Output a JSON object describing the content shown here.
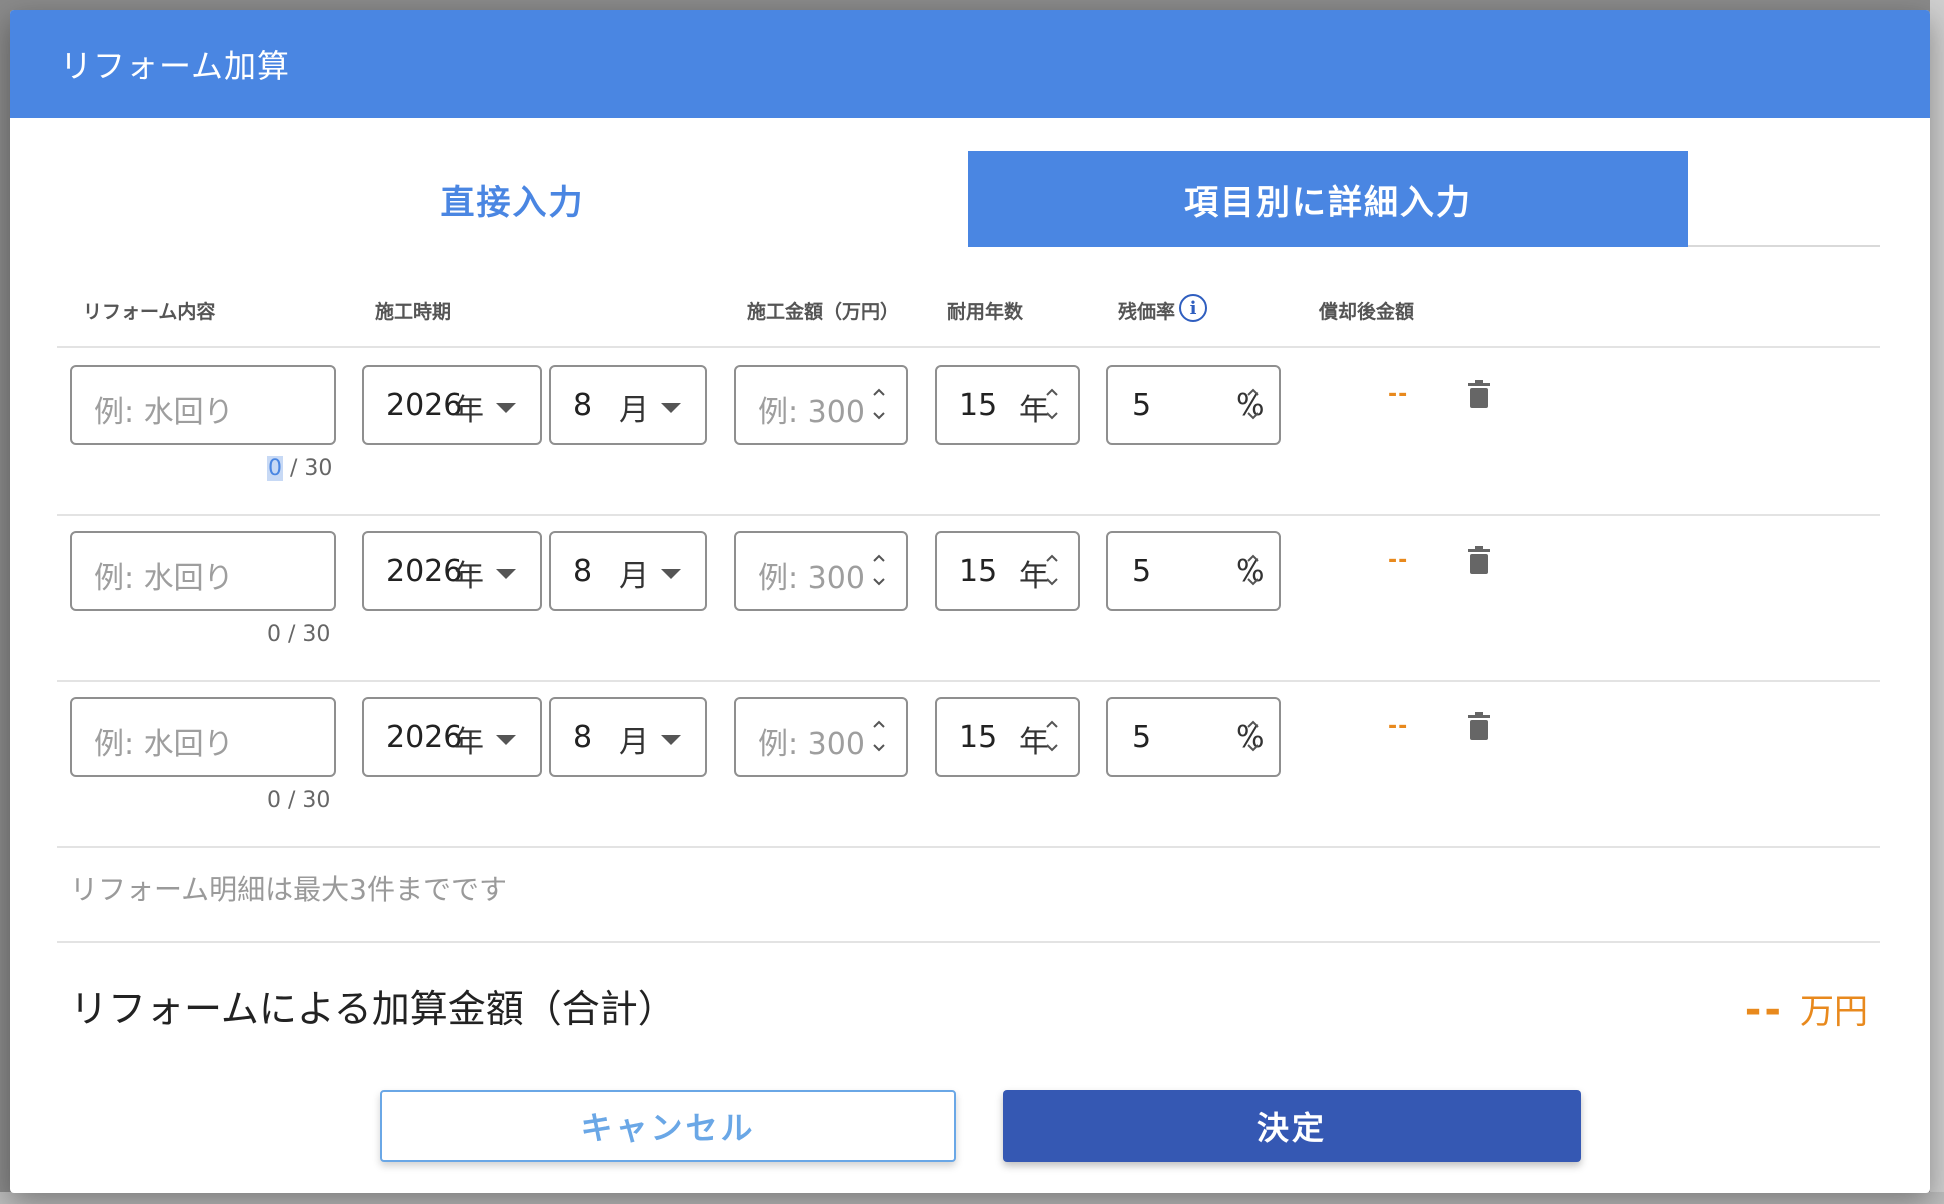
{
  "dialog": {
    "title": "リフォーム加算"
  },
  "tabs": [
    {
      "label": "直接入力",
      "active": false
    },
    {
      "label": "項目別に詳細入力",
      "active": true
    }
  ],
  "columns": {
    "content": "リフォーム内容",
    "period": "施工時期",
    "amount": "施工金額（万円）",
    "life": "耐用年数",
    "residual": "残価率",
    "after": "償却後金額"
  },
  "rows": [
    {
      "content_placeholder": "例: 水回り",
      "counter_current": "0",
      "counter_rest": " / 30",
      "year": "2026",
      "year_unit": "年",
      "month": "8",
      "month_unit": "月",
      "amount_placeholder": "例: 300",
      "life": "15",
      "life_unit": "年",
      "residual": "5",
      "residual_unit": "%",
      "after_value": "--"
    },
    {
      "content_placeholder": "例: 水回り",
      "counter": "0 / 30",
      "year": "2026",
      "year_unit": "年",
      "month": "8",
      "month_unit": "月",
      "amount_placeholder": "例: 300",
      "life": "15",
      "life_unit": "年",
      "residual": "5",
      "residual_unit": "%",
      "after_value": "--"
    },
    {
      "content_placeholder": "例: 水回り",
      "counter": "0 / 30",
      "year": "2026",
      "year_unit": "年",
      "month": "8",
      "month_unit": "月",
      "amount_placeholder": "例: 300",
      "life": "15",
      "life_unit": "年",
      "residual": "5",
      "residual_unit": "%",
      "after_value": "--"
    }
  ],
  "note": "リフォーム明細は最大3件までです",
  "total": {
    "label": "リフォームによる加算金額（合計）",
    "value": "--",
    "unit": "万円"
  },
  "buttons": {
    "cancel": "キャンセル",
    "ok": "決定"
  },
  "colors": {
    "header": "#4a86e2",
    "primary_button": "#3558b3",
    "accent_orange": "#e8891d"
  }
}
